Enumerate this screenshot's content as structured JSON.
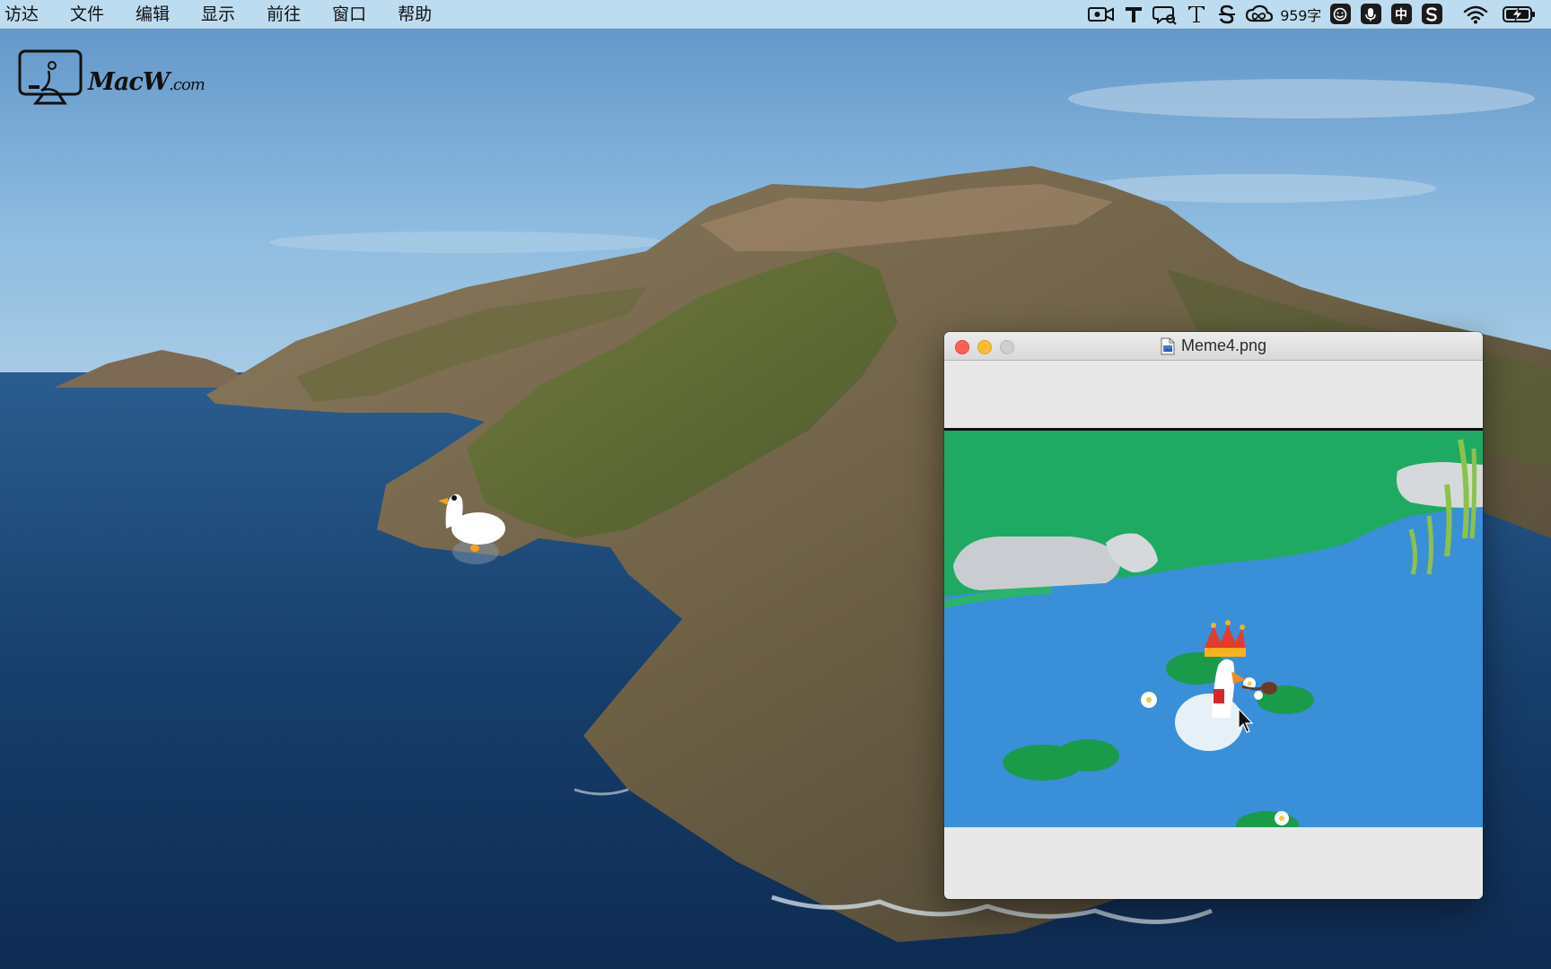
{
  "menubar": {
    "items": [
      "访达",
      "文件",
      "编辑",
      "显示",
      "前往",
      "窗口",
      "帮助"
    ],
    "word_count": "959字",
    "tray_icons": [
      "screen-record-icon",
      "text-t-icon",
      "chat-search-icon",
      "text-serif-t-icon",
      "strikethrough-s-icon",
      "creative-cloud-icon",
      "word-count",
      "smile-face-icon",
      "microphone-icon",
      "input-method-icon",
      "sogou-s-icon",
      "wifi-icon",
      "battery-charging-icon"
    ],
    "input_method_label": "中"
  },
  "watermark": {
    "brand": "MacW",
    "suffix": ".com"
  },
  "window": {
    "title": "Meme4.png",
    "image_description_icon": "png-file-icon"
  },
  "colors": {
    "menubar": "#c6e2f2",
    "close": "#fe5f57",
    "minimize": "#febc2e",
    "zoom_disabled": "#cfcfcf",
    "pond_water": "#3a8fd9",
    "pond_grass": "#1faa63"
  }
}
